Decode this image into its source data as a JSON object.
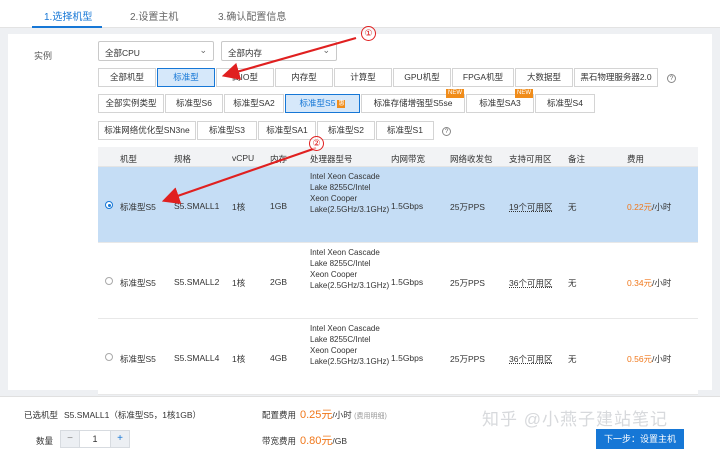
{
  "steps": [
    "1.选择机型",
    "2.设置主机",
    "3.确认配置信息"
  ],
  "instance_label": "实例",
  "selects": {
    "cpu": "全部CPU",
    "memory": "全部内存"
  },
  "family_tabs": [
    "全部机型",
    "标准型",
    "高IO型",
    "内存型",
    "计算型",
    "GPU机型",
    "FPGA机型",
    "大数据型",
    "黑石物理服务器2.0"
  ],
  "type_tabs_row1": [
    "全部实例类型",
    "标准型S6",
    "标准型SA2",
    "标准型S5",
    "标准存储增强型S5se",
    "标准型SA3",
    "标准型S4"
  ],
  "type_tabs_row2": [
    "标准网络优化型SN3ne",
    "标准型S3",
    "标准型SA1",
    "标准型S2",
    "标准型S1"
  ],
  "badges": {
    "new": "NEW",
    "hot": "惠"
  },
  "table": {
    "headers": [
      "机型",
      "规格",
      "vCPU",
      "内存",
      "处理器型号",
      "内网带宽",
      "网络收发包",
      "支持可用区",
      "备注",
      "费用"
    ],
    "rows": [
      {
        "type": "标准型S5",
        "spec": "S5.SMALL1",
        "vcpu": "1核",
        "mem": "1GB",
        "cpu": "Intel Xeon Cascade Lake 8255C/Intel Xeon Cooper Lake(2.5GHz/3.1GHz)",
        "bw": "1.5Gbps",
        "pps": "25万PPS",
        "zones": "19个可用区",
        "note": "无",
        "price": "0.22元",
        "unit": "/小时"
      },
      {
        "type": "标准型S5",
        "spec": "S5.SMALL2",
        "vcpu": "1核",
        "mem": "2GB",
        "cpu": "Intel Xeon Cascade Lake 8255C/Intel Xeon Cooper Lake(2.5GHz/3.1GHz)",
        "bw": "1.5Gbps",
        "pps": "25万PPS",
        "zones": "36个可用区",
        "note": "无",
        "price": "0.34元",
        "unit": "/小时"
      },
      {
        "type": "标准型S5",
        "spec": "S5.SMALL4",
        "vcpu": "1核",
        "mem": "4GB",
        "cpu": "Intel Xeon Cascade Lake 8255C/Intel Xeon Cooper Lake(2.5GHz/3.1GHz)",
        "bw": "1.5Gbps",
        "pps": "25万PPS",
        "zones": "36个可用区",
        "note": "无",
        "price": "0.56元",
        "unit": "/小时"
      }
    ]
  },
  "footer": {
    "selected_label": "已选机型",
    "selected_value": "S5.SMALL1（标准型S5，1核1GB）",
    "qty_label": "数量",
    "qty_value": "1",
    "minus": "−",
    "plus": "+",
    "config_fee_label": "配置费用",
    "config_fee": "0.25元",
    "config_fee_unit": "/小时",
    "config_fee_note": "(费用明细)",
    "bw_fee_label": "带宽费用",
    "bw_fee": "0.80元",
    "bw_fee_unit": "/GB",
    "next_button": "下一步：设置主机"
  },
  "watermark": "知乎 @小燕子建站笔记",
  "annotations": [
    "①",
    "②"
  ],
  "colors": {
    "accent": "#1677d6",
    "price": "#f0771a",
    "badge": "#f08c1a",
    "annotation": "#e02020"
  }
}
